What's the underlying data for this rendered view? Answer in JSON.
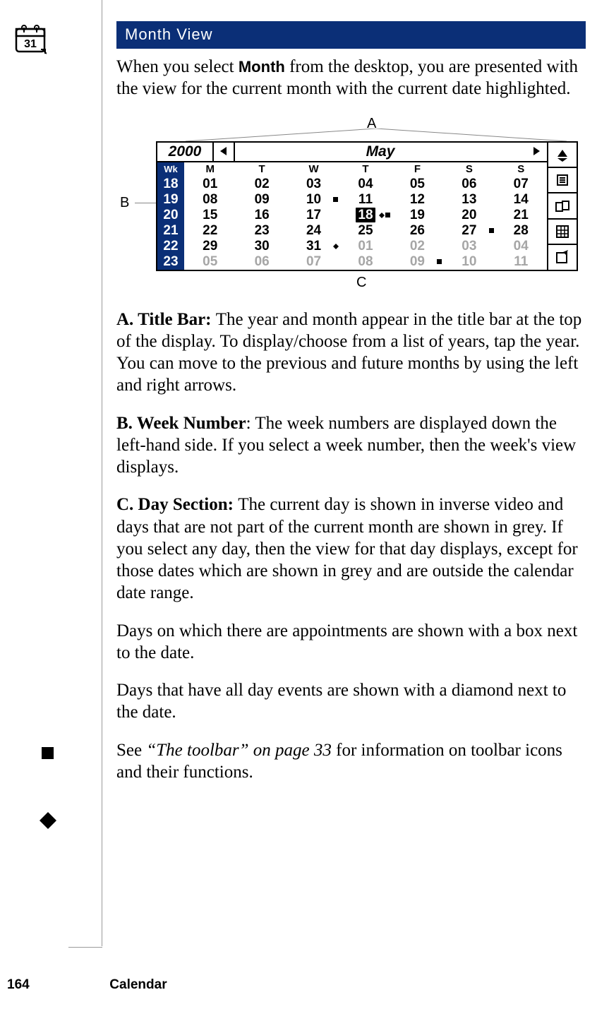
{
  "section_title": "Month View",
  "para_intro_a": "When you select ",
  "para_intro_strong": "Month",
  "para_intro_b": " from the desktop, you are presented with the view for the current month with the current date highlighted.",
  "callouts": {
    "a": "A",
    "b": "B",
    "c": "C"
  },
  "calendar": {
    "year": "2000",
    "month": "May",
    "week_header": "Wk",
    "week_numbers": [
      "18",
      "19",
      "20",
      "21",
      "22",
      "23"
    ],
    "day_headers": [
      "M",
      "T",
      "W",
      "T",
      "F",
      "S",
      "S"
    ],
    "rows": [
      [
        {
          "d": "01"
        },
        {
          "d": "02"
        },
        {
          "d": "03"
        },
        {
          "d": "04"
        },
        {
          "d": "05"
        },
        {
          "d": "06"
        },
        {
          "d": "07"
        }
      ],
      [
        {
          "d": "08"
        },
        {
          "d": "09"
        },
        {
          "d": "10",
          "m": "box"
        },
        {
          "d": "11"
        },
        {
          "d": "12"
        },
        {
          "d": "13"
        },
        {
          "d": "14"
        }
      ],
      [
        {
          "d": "15"
        },
        {
          "d": "16"
        },
        {
          "d": "17"
        },
        {
          "d": "18",
          "sel": true,
          "m": "both"
        },
        {
          "d": "19"
        },
        {
          "d": "20"
        },
        {
          "d": "21"
        }
      ],
      [
        {
          "d": "22"
        },
        {
          "d": "23"
        },
        {
          "d": "24"
        },
        {
          "d": "25"
        },
        {
          "d": "26"
        },
        {
          "d": "27",
          "m": "box"
        },
        {
          "d": "28"
        }
      ],
      [
        {
          "d": "29"
        },
        {
          "d": "30"
        },
        {
          "d": "31",
          "m": "dia"
        },
        {
          "d": "01",
          "out": true
        },
        {
          "d": "02",
          "out": true
        },
        {
          "d": "03",
          "out": true
        },
        {
          "d": "04",
          "out": true
        }
      ],
      [
        {
          "d": "05",
          "out": true
        },
        {
          "d": "06",
          "out": true
        },
        {
          "d": "07",
          "out": true
        },
        {
          "d": "08",
          "out": true
        },
        {
          "d": "09",
          "out": true,
          "m": "box"
        },
        {
          "d": "10",
          "out": true
        },
        {
          "d": "11",
          "out": true
        }
      ]
    ],
    "toolbar_icons": [
      "zoom-toggle-icon",
      "day-view-icon",
      "week-view-icon",
      "grid-view-icon",
      "new-entry-icon"
    ]
  },
  "para_a_label": "A. Title Bar: ",
  "para_a": "The year and month appear in the title bar at the top of the display. To display/choose from a list of years, tap the year. You can move to the previous and future months by using the left and right arrows.",
  "para_b_label": "B. Week Number",
  "para_b": ": The week numbers are displayed down the left-hand side. If you select a week number, then the week's view displays.",
  "para_c_label": "C. Day Section: ",
  "para_c": "The current day is shown in inverse video and days that are not part of the current month are shown in grey. If you select any day, then the view for that day displays, except for those dates which are shown in grey and are outside the calendar date range.",
  "para_box": "Days on which there are appointments are shown with a box next to the date.",
  "para_dia": "Days that have all day events are shown with a diamond next to the date.",
  "para_see_a": "See ",
  "para_see_i": "“The toolbar” on page 33",
  "para_see_b": " for information on toolbar icons and their functions.",
  "footer": {
    "page": "164",
    "label": "Calendar"
  }
}
